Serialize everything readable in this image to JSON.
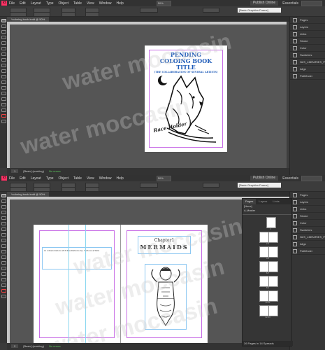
{
  "menu": {
    "logo": "Id",
    "items": [
      "File",
      "Edit",
      "Layout",
      "Type",
      "Object",
      "Table",
      "View",
      "Window",
      "Help"
    ],
    "zoom": "50%",
    "publish": "Publish Online",
    "workspace": "Essentials"
  },
  "control": {
    "style_dropdown": "[Basic Graphics Frame]"
  },
  "doc_tab": "*coloring book.indd @ 50%",
  "panel_items": [
    {
      "label": "Pages",
      "icon": "pages-icon"
    },
    {
      "label": "Layers",
      "icon": "layers-icon"
    },
    {
      "label": "Links",
      "icon": "links-icon"
    },
    {
      "label": "Stroke",
      "icon": "stroke-icon"
    },
    {
      "label": "Color",
      "icon": "color-icon"
    },
    {
      "label": "Swatches",
      "icon": "swatches-icon"
    },
    {
      "label": "NZS_LIBRARIES_PA...",
      "icon": "library-icon"
    },
    {
      "label": "Align",
      "icon": "align-icon"
    },
    {
      "label": "Pathfinder",
      "icon": "pathfinder-icon"
    }
  ],
  "status": {
    "page": "1",
    "master": "[Basic] (working)",
    "errors": "No errors"
  },
  "status2": {
    "page": "2",
    "master": "[Basic] (working)",
    "errors": "No errors"
  },
  "cover": {
    "line1": "PENDING",
    "line2": "COLOING BOOK",
    "line3": "TITLE",
    "line4": "(THE COLLABORATION OF SEVERAL ARTISTS)",
    "signature": "Race Holder"
  },
  "spread": {
    "left_text": "in collaboration with illustrations by: Various artists",
    "chapter": "Chapter1",
    "title": "MERMAIDS"
  },
  "pages_panel": {
    "tabs": [
      "Pages",
      "Layers",
      "Links"
    ],
    "none": "[None]",
    "master": "A-Master",
    "labels": [
      "1",
      "2-3",
      "4-5",
      "6-7",
      "8-9",
      "10-11",
      "12-13"
    ],
    "status": "26 Pages in 14 Spreads"
  },
  "watermark": "water moccasin"
}
